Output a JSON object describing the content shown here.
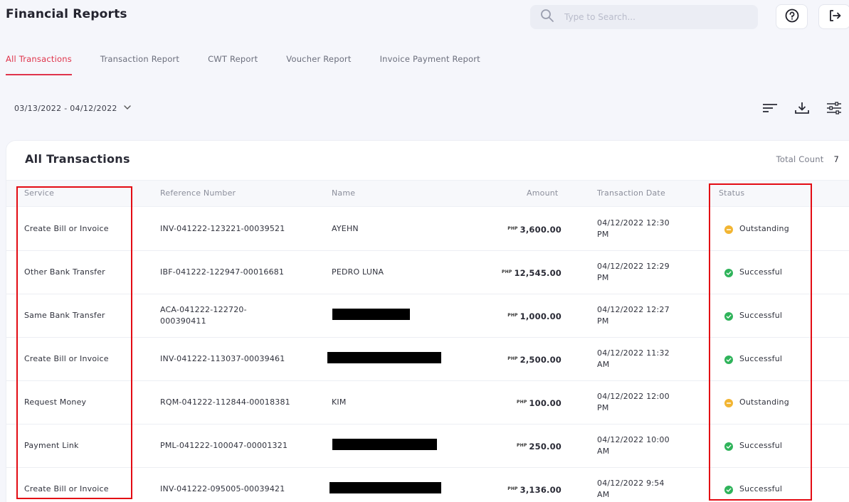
{
  "header": {
    "title": "Financial Reports",
    "search_placeholder": "Type to Search..."
  },
  "tabs": [
    {
      "label": "All Transactions",
      "active": true
    },
    {
      "label": "Transaction Report",
      "active": false
    },
    {
      "label": "CWT Report",
      "active": false
    },
    {
      "label": "Voucher Report",
      "active": false
    },
    {
      "label": "Invoice Payment Report",
      "active": false
    }
  ],
  "filters": {
    "date_range": "03/13/2022 - 04/12/2022"
  },
  "card": {
    "title": "All Transactions",
    "total_label": "Total Count",
    "total_value": "7"
  },
  "table": {
    "columns": [
      "Service",
      "Reference Number",
      "Name",
      "Amount",
      "Transaction Date",
      "Status"
    ],
    "currency": "PHP",
    "rows": [
      {
        "service": "Create Bill or Invoice",
        "ref": "INV-041222-123221-00039521",
        "name": "AYEHN",
        "amount": "3,600.00",
        "date": "04/12/2022 12:30",
        "date2": "PM",
        "status": "Outstanding"
      },
      {
        "service": "Other Bank Transfer",
        "ref": "IBF-041222-122947-00016681",
        "name": "PEDRO LUNA",
        "amount": "12,545.00",
        "date": "04/12/2022 12:29",
        "date2": "PM",
        "status": "Successful"
      },
      {
        "service": "Same Bank Transfer",
        "ref": "ACA-041222-122720-",
        "ref2": "000390411",
        "name": "",
        "amount": "1,000.00",
        "date": "04/12/2022 12:27",
        "date2": "PM",
        "status": "Successful"
      },
      {
        "service": "Create Bill or Invoice",
        "ref": "INV-041222-113037-00039461",
        "name": "",
        "amount": "2,500.00",
        "date": "04/12/2022 11:32",
        "date2": "AM",
        "status": "Successful"
      },
      {
        "service": "Request Money",
        "ref": "RQM-041222-112844-00018381",
        "name": "KIM",
        "amount": "100.00",
        "date": "04/12/2022 12:00",
        "date2": "PM",
        "status": "Outstanding"
      },
      {
        "service": "Payment Link",
        "ref": "PML-041222-100047-00001321",
        "name": "",
        "amount": "250.00",
        "date": "04/12/2022 10:00",
        "date2": "AM",
        "status": "Successful"
      },
      {
        "service": "Create Bill or Invoice",
        "ref": "INV-041222-095005-00039421",
        "name": "",
        "amount": "3,136.00",
        "date": "04/12/2022 9:54",
        "date2": "AM",
        "status": "Successful"
      }
    ]
  },
  "colors": {
    "accent": "#e0344b",
    "outstanding": "#f2b532",
    "successful": "#2fb35a",
    "highlight_box": "#e30b13"
  }
}
